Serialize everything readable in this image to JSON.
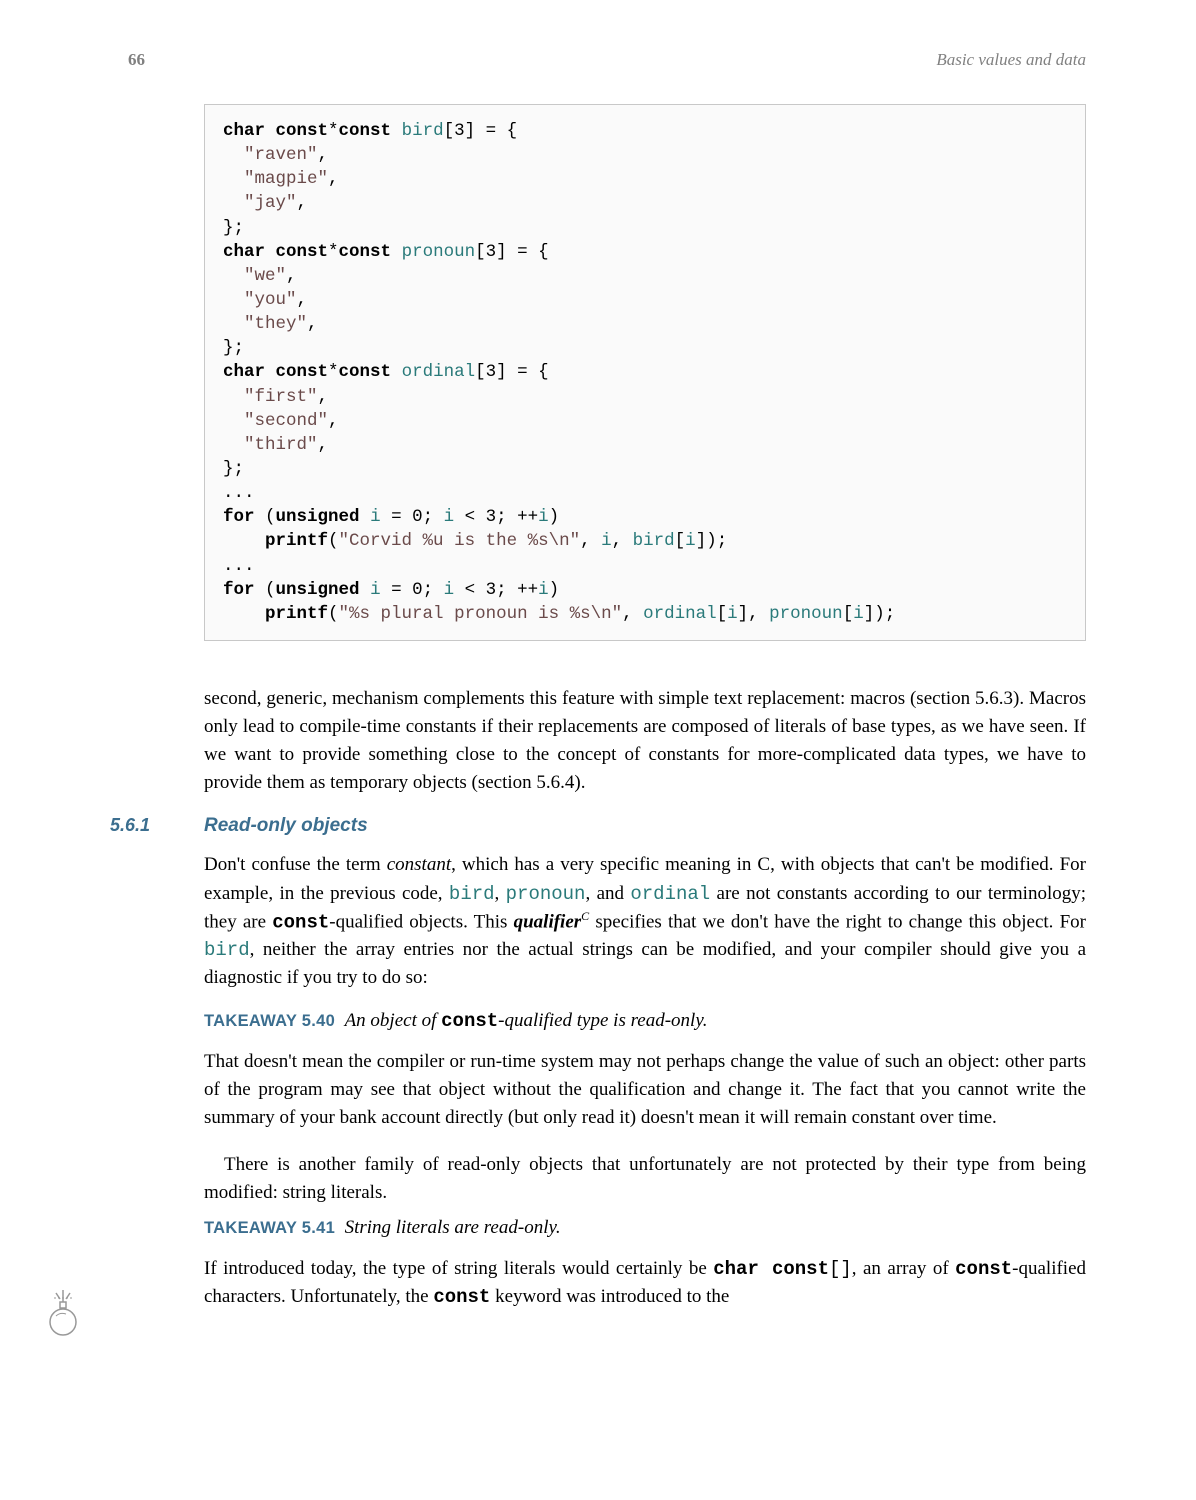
{
  "page_number": "66",
  "chapter_title": "Basic values and data",
  "code_lines": [
    [
      [
        "kw",
        "char const"
      ],
      [
        "punc",
        "*"
      ],
      [
        "kw",
        "const"
      ],
      [
        "punc",
        " "
      ],
      [
        "id",
        "bird"
      ],
      [
        "punc",
        "[3] = {"
      ]
    ],
    [
      [
        "punc",
        "  "
      ],
      [
        "str",
        "\"raven\""
      ],
      [
        "punc",
        ","
      ]
    ],
    [
      [
        "punc",
        "  "
      ],
      [
        "str",
        "\"magpie\""
      ],
      [
        "punc",
        ","
      ]
    ],
    [
      [
        "punc",
        "  "
      ],
      [
        "str",
        "\"jay\""
      ],
      [
        "punc",
        ","
      ]
    ],
    [
      [
        "punc",
        "};"
      ]
    ],
    [
      [
        "kw",
        "char const"
      ],
      [
        "punc",
        "*"
      ],
      [
        "kw",
        "const"
      ],
      [
        "punc",
        " "
      ],
      [
        "id",
        "pronoun"
      ],
      [
        "punc",
        "[3] = {"
      ]
    ],
    [
      [
        "punc",
        "  "
      ],
      [
        "str",
        "\"we\""
      ],
      [
        "punc",
        ","
      ]
    ],
    [
      [
        "punc",
        "  "
      ],
      [
        "str",
        "\"you\""
      ],
      [
        "punc",
        ","
      ]
    ],
    [
      [
        "punc",
        "  "
      ],
      [
        "str",
        "\"they\""
      ],
      [
        "punc",
        ","
      ]
    ],
    [
      [
        "punc",
        "};"
      ]
    ],
    [
      [
        "kw",
        "char const"
      ],
      [
        "punc",
        "*"
      ],
      [
        "kw",
        "const"
      ],
      [
        "punc",
        " "
      ],
      [
        "id",
        "ordinal"
      ],
      [
        "punc",
        "[3] = {"
      ]
    ],
    [
      [
        "punc",
        "  "
      ],
      [
        "str",
        "\"first\""
      ],
      [
        "punc",
        ","
      ]
    ],
    [
      [
        "punc",
        "  "
      ],
      [
        "str",
        "\"second\""
      ],
      [
        "punc",
        ","
      ]
    ],
    [
      [
        "punc",
        "  "
      ],
      [
        "str",
        "\"third\""
      ],
      [
        "punc",
        ","
      ]
    ],
    [
      [
        "punc",
        "};"
      ]
    ],
    [
      [
        "punc",
        "..."
      ]
    ],
    [
      [
        "kw",
        "for"
      ],
      [
        "punc",
        " ("
      ],
      [
        "kw",
        "unsigned"
      ],
      [
        "punc",
        " "
      ],
      [
        "id",
        "i"
      ],
      [
        "punc",
        " = 0; "
      ],
      [
        "id",
        "i"
      ],
      [
        "punc",
        " < 3; ++"
      ],
      [
        "id",
        "i"
      ],
      [
        "punc",
        ")"
      ]
    ],
    [
      [
        "punc",
        "    "
      ],
      [
        "kw",
        "printf"
      ],
      [
        "punc",
        "("
      ],
      [
        "str",
        "\"Corvid %u is the %s\\n\""
      ],
      [
        "punc",
        ", "
      ],
      [
        "id",
        "i"
      ],
      [
        "punc",
        ", "
      ],
      [
        "id",
        "bird"
      ],
      [
        "punc",
        "["
      ],
      [
        "id",
        "i"
      ],
      [
        "punc",
        "]);"
      ]
    ],
    [
      [
        "punc",
        "..."
      ]
    ],
    [
      [
        "kw",
        "for"
      ],
      [
        "punc",
        " ("
      ],
      [
        "kw",
        "unsigned"
      ],
      [
        "punc",
        " "
      ],
      [
        "id",
        "i"
      ],
      [
        "punc",
        " = 0; "
      ],
      [
        "id",
        "i"
      ],
      [
        "punc",
        " < 3; ++"
      ],
      [
        "id",
        "i"
      ],
      [
        "punc",
        ")"
      ]
    ],
    [
      [
        "punc",
        "    "
      ],
      [
        "kw",
        "printf"
      ],
      [
        "punc",
        "("
      ],
      [
        "str",
        "\"%s plural pronoun is %s\\n\""
      ],
      [
        "punc",
        ", "
      ],
      [
        "id",
        "ordinal"
      ],
      [
        "punc",
        "["
      ],
      [
        "id",
        "i"
      ],
      [
        "punc",
        "], "
      ],
      [
        "id",
        "pronoun"
      ],
      [
        "punc",
        "["
      ],
      [
        "id",
        "i"
      ],
      [
        "punc",
        "]);"
      ]
    ]
  ],
  "para1": "second, generic, mechanism complements this feature with simple text replacement: macros (section 5.6.3). Macros only lead to compile-time constants if their replacements are composed of literals of base types, as we have seen. If we want to provide something close to the concept of constants for more-complicated data types, we have to provide them as temporary objects (section 5.6.4).",
  "section_number": "5.6.1",
  "section_title": "Read-only objects",
  "para2_a": "Don't confuse the term ",
  "para2_term1": "constant",
  "para2_b": ", which has a very specific meaning in C, with objects that can't be modified. For example, in the previous code, ",
  "para2_code1": "bird",
  "para2_c": ", ",
  "para2_code2": "pronoun",
  "para2_d": ", and ",
  "para2_code3": "ordinal",
  "para2_e": " are not constants according to our terminology; they are ",
  "para2_kw1": "const",
  "para2_f": "-qualified objects. This ",
  "para2_term2": "qualifier",
  "para2_sup": "C",
  "para2_g": " specifies that we don't have the right to change this object. For ",
  "para2_code4": "bird",
  "para2_h": ", neither the array entries nor the actual strings can be modified, and your compiler should give you a diagnostic if you try to do so:",
  "takeaway1_label": "TAKEAWAY 5.40",
  "takeaway1_a": "An object of ",
  "takeaway1_kw": "const",
  "takeaway1_b": "-qualified type is read-only.",
  "para3": "That doesn't mean the compiler or run-time system may not perhaps change the value of such an object: other parts of the program may see that object without the qualification and change it. The fact that you cannot write the summary of your bank account directly (but only read it) doesn't mean it will remain constant over time.",
  "para4": "There is another family of read-only objects that unfortunately are not protected by their type from being modified: string literals.",
  "takeaway2_label": "TAKEAWAY 5.41",
  "takeaway2_body": "String literals are read-only.",
  "para5_a": "If introduced today, the type of string literals would certainly be ",
  "para5_kw1": "char  const",
  "para5_code1": "[]",
  "para5_b": ", an array of ",
  "para5_kw2": "const",
  "para5_c": "-qualified characters. Unfortunately, the ",
  "para5_kw3": "const",
  "para5_d": " keyword was introduced to the"
}
